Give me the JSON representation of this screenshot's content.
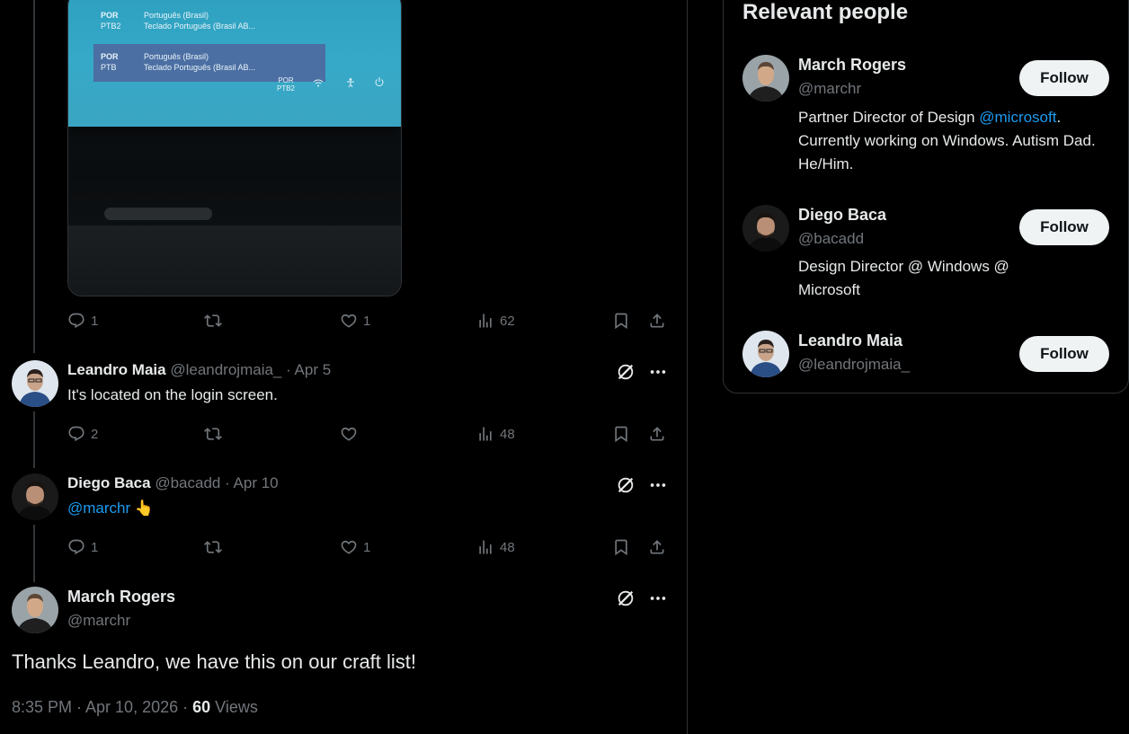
{
  "media": {
    "lang_rows": [
      {
        "code": "POR",
        "sub": "PTB2",
        "line1": "Português (Brasil)",
        "line2": "Teclado Português (Brasil AB..."
      },
      {
        "code": "POR",
        "sub": "PTB",
        "line1": "Português (Brasil)",
        "line2": "Teclado Português (Brasil AB..."
      }
    ],
    "tray_code": "POR",
    "tray_sub": "PTB2"
  },
  "photo_tweet_actions": {
    "replies": "1",
    "reposts": "",
    "likes": "1",
    "views": "62"
  },
  "replies": [
    {
      "name": "Leandro Maia",
      "meta": "@leandrojmaia_ · Apr 5",
      "text": "It's located on the login screen.",
      "actions": {
        "replies": "2",
        "reposts": "",
        "likes": "",
        "views": "48"
      }
    },
    {
      "name": "Diego Baca",
      "meta": "@bacadd · Apr 10",
      "mention": "@marchr",
      "emoji": "👆",
      "actions": {
        "replies": "1",
        "reposts": "",
        "likes": "1",
        "views": "48"
      }
    }
  ],
  "main_tweet": {
    "name": "March Rogers",
    "handle": "@marchr",
    "text": "Thanks Leandro, we have this on our craft list!",
    "timestamp": "8:35 PM · Apr 10, 2026 · ",
    "views_count": "60",
    "views_label": " Views"
  },
  "sidebar": {
    "title": "Relevant people",
    "people": [
      {
        "name": "March Rogers",
        "handle": "@marchr",
        "bio_pre": "Partner Director of Design ",
        "bio_mention": "@microsoft",
        "bio_post": ". Currently working on Windows. Autism Dad. He/Him.",
        "follow_label": "Follow"
      },
      {
        "name": "Diego Baca",
        "handle": "@bacadd",
        "bio_pre": "Design Director @ Windows @ Microsoft",
        "bio_mention": "",
        "bio_post": "",
        "follow_label": "Follow"
      },
      {
        "name": "Leandro Maia",
        "handle": "@leandrojmaia_",
        "bio_pre": "",
        "bio_mention": "",
        "bio_post": "",
        "follow_label": "Follow"
      }
    ]
  },
  "icons": {
    "reply": "reply-icon",
    "repost": "repost-icon",
    "like": "like-icon",
    "views": "views-icon",
    "bookmark": "bookmark-icon",
    "share": "share-icon",
    "grok": "grok-icon",
    "more": "more-icon"
  },
  "colors": {
    "background": "#000000",
    "text": "#e7e9ea",
    "muted": "#71767b",
    "link": "#1d9bf0",
    "border": "#2f3336",
    "follow_bg": "#eff3f4"
  }
}
